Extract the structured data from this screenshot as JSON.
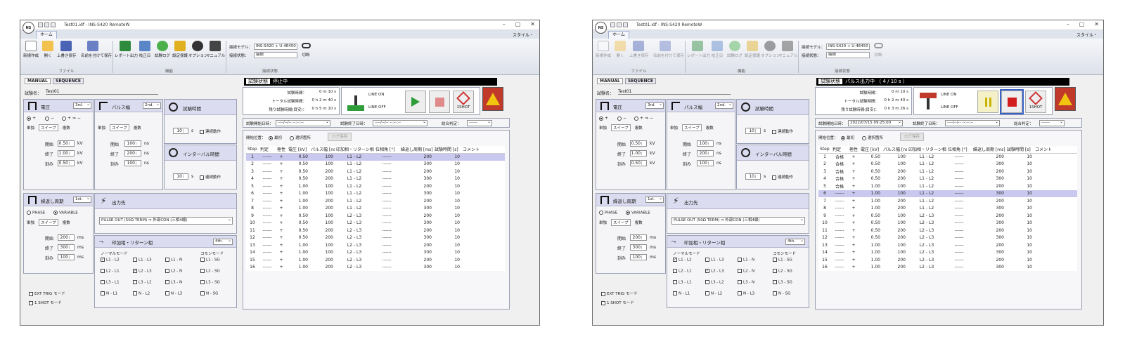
{
  "windows": [
    {
      "title": "Test01.idf - INS-S420 RemoteW",
      "tab_home": "ホーム",
      "style_label": "スタイル・",
      "ribbon": {
        "buttons": [
          "新規作成",
          "開く",
          "上書き保存",
          "名前を付けて保存",
          "レポート出力",
          "校正日",
          "試験ログ",
          "設定保護",
          "オプション",
          "マニュアル"
        ],
        "groups": [
          "ファイル",
          "機能",
          "接続状態"
        ],
        "conn_model_label": "接続モデル：",
        "conn_model_value": "INS-S420 + U-4E450",
        "conn_state_label": "接続状態：",
        "conn_state_value": "接続",
        "disconnect": "切断"
      },
      "mode_tabs": [
        "MANUAL",
        "SEQUENCE"
      ],
      "test_name_label": "試験名：",
      "test_name_value": "Test01",
      "voltage": {
        "title": "電圧",
        "order": "3rd.",
        "polarity": [
          "+",
          "−",
          "+ ⇒ −"
        ],
        "subtabs": [
          "単独",
          "スイープ",
          "複数"
        ],
        "rows": [
          {
            "label": "開始",
            "value": "0.50",
            "unit": "kV"
          },
          {
            "label": "終了",
            "value": "1.00",
            "unit": "kV"
          },
          {
            "label": "刻み",
            "value": "0.50",
            "unit": "kV"
          }
        ]
      },
      "pulse": {
        "title": "パルス幅",
        "order": "2nd.",
        "subtabs": [
          "単独",
          "スイープ",
          "複数"
        ],
        "rows": [
          {
            "label": "開始",
            "value": "100",
            "unit": "ns"
          },
          {
            "label": "終了",
            "value": "200",
            "unit": "ns"
          },
          {
            "label": "刻み",
            "value": "100",
            "unit": "ns"
          }
        ]
      },
      "test_time": {
        "title": "試験時間",
        "value": "10",
        "unit": "s",
        "chk": "連続動作"
      },
      "interval": {
        "title": "インターバル時間",
        "value": "10",
        "unit": "s",
        "chk": "連続動作"
      },
      "repeat": {
        "title": "繰返し周期",
        "order": "1st.",
        "modes": [
          "PHASE",
          "VARIABLE"
        ],
        "subtabs": [
          "単独",
          "スイープ",
          "複数"
        ],
        "rows": [
          {
            "label": "開始",
            "value": "200",
            "unit": "ms"
          },
          {
            "label": "終了",
            "value": "300",
            "unit": "ms"
          },
          {
            "label": "刻み",
            "value": "100",
            "unit": "ms"
          }
        ]
      },
      "output": {
        "title": "出力先",
        "value": "PULSE OUT (50Ω TERM) ⇒ 外部CDN (三相4線)"
      },
      "apply_phase": {
        "title": "印加相・リターン相",
        "order": "4th.",
        "normal_label": "ノーマルモード",
        "common_label": "コモンモード",
        "normal": [
          [
            "L1 - L2",
            "L1 - L3",
            "L1 - N"
          ],
          [
            "L2 - L1",
            "L2 - L3",
            "L2 - N"
          ],
          [
            "L3 - L1",
            "L3 - L2",
            "L3 - N"
          ],
          [
            "N - L1",
            "N - L2",
            "N - L3"
          ]
        ],
        "normal_checked": [
          [
            true,
            false,
            false
          ],
          [
            false,
            true,
            false
          ],
          [
            false,
            false,
            false
          ],
          [
            false,
            false,
            false
          ]
        ],
        "common": [
          "L1 - SG",
          "L2 - SG",
          "L3 - SG",
          "N - SG"
        ]
      },
      "ext_trig": "EXT TRIG モード",
      "one_shot_mode": "1 SHOT モード",
      "status": {
        "label": "試験状態",
        "value": "停止中"
      },
      "times": [
        {
          "label": "試験時間：",
          "value": "0 m  10 s"
        },
        {
          "label": "トータル試験時間：",
          "value": "0 h   2 m  40 s"
        },
        {
          "label": "残り試験時間(目安)：",
          "value": "0 h   5 m  10 s"
        }
      ],
      "line_on": "LINE ON",
      "line_off": "LINE OFF",
      "one_shot": "1SHOT",
      "start_label": "試験開始日時：",
      "start_value": "----/--/-- --:--:--",
      "end_label": "試験終了日時：",
      "end_value": "----/--/-- --:--:--",
      "verdict_label": "総合判定：",
      "verdict_value": "------",
      "start_pos_label": "開始位置：",
      "start_pos_opts": [
        "最初",
        "選択箇所"
      ],
      "log_save": "ログ保存",
      "table": {
        "headers": [
          "Step",
          "判定",
          "極性",
          "電圧 [kV]",
          "パルス幅 [ns]",
          "印加相・リターン相",
          "位相角 [°]",
          "繰返し周期 [ms]",
          "試験時間 [s]",
          "コメント"
        ],
        "rows": [
          [
            "1",
            "------",
            "+",
            "0.50",
            "100",
            "L1 - L2",
            "------",
            "200",
            "10"
          ],
          [
            "2",
            "------",
            "+",
            "0.50",
            "100",
            "L1 - L2",
            "------",
            "300",
            "10"
          ],
          [
            "3",
            "------",
            "+",
            "0.50",
            "200",
            "L1 - L2",
            "------",
            "200",
            "10"
          ],
          [
            "4",
            "------",
            "+",
            "0.50",
            "200",
            "L1 - L2",
            "------",
            "300",
            "10"
          ],
          [
            "5",
            "------",
            "+",
            "1.00",
            "100",
            "L1 - L2",
            "------",
            "200",
            "10"
          ],
          [
            "6",
            "------",
            "+",
            "1.00",
            "100",
            "L1 - L2",
            "------",
            "300",
            "10"
          ],
          [
            "7",
            "------",
            "+",
            "1.00",
            "200",
            "L1 - L2",
            "------",
            "200",
            "10"
          ],
          [
            "8",
            "------",
            "+",
            "1.00",
            "200",
            "L1 - L2",
            "------",
            "300",
            "10"
          ],
          [
            "9",
            "------",
            "+",
            "0.50",
            "100",
            "L2 - L3",
            "------",
            "200",
            "10"
          ],
          [
            "10",
            "------",
            "+",
            "0.50",
            "100",
            "L2 - L3",
            "------",
            "300",
            "10"
          ],
          [
            "11",
            "------",
            "+",
            "0.50",
            "200",
            "L2 - L3",
            "------",
            "200",
            "10"
          ],
          [
            "12",
            "------",
            "+",
            "0.50",
            "200",
            "L2 - L3",
            "------",
            "300",
            "10"
          ],
          [
            "13",
            "------",
            "+",
            "1.00",
            "100",
            "L2 - L3",
            "------",
            "200",
            "10"
          ],
          [
            "14",
            "------",
            "+",
            "1.00",
            "100",
            "L2 - L3",
            "------",
            "300",
            "10"
          ],
          [
            "15",
            "------",
            "+",
            "1.00",
            "200",
            "L2 - L3",
            "------",
            "200",
            "10"
          ],
          [
            "16",
            "------",
            "+",
            "1.00",
            "200",
            "L2 - L3",
            "------",
            "300",
            "10"
          ]
        ]
      }
    },
    {
      "title": "Test01.idf - INS-S420 RemoteW",
      "tab_home": "ホーム",
      "style_label": "スタイル・",
      "ribbon": {
        "buttons": [
          "新規作成",
          "開く",
          "上書き保存",
          "名前を付けて保存",
          "レポート出力",
          "校正日",
          "試験ログ",
          "設定保護",
          "オプション",
          "マニュアル"
        ],
        "groups": [
          "ファイル",
          "機能",
          "接続状態"
        ],
        "conn_model_label": "接続モデル：",
        "conn_model_value": "INS-S420 + U-4E450",
        "conn_state_label": "接続状態：",
        "conn_state_value": "接続",
        "disconnect": "切断"
      },
      "mode_tabs": [
        "MANUAL",
        "SEQUENCE"
      ],
      "test_name_label": "試験名：",
      "test_name_value": "Test01",
      "voltage": {
        "title": "電圧",
        "order": "3rd.",
        "polarity": [
          "+",
          "−",
          "+ ⇒ −"
        ],
        "subtabs": [
          "単独",
          "スイープ",
          "複数"
        ],
        "rows": [
          {
            "label": "開始",
            "value": "0.50",
            "unit": "kV"
          },
          {
            "label": "終了",
            "value": "1.00",
            "unit": "kV"
          },
          {
            "label": "刻み",
            "value": "0.50",
            "unit": "kV"
          }
        ]
      },
      "pulse": {
        "title": "パルス幅",
        "order": "2nd.",
        "subtabs": [
          "単独",
          "スイープ",
          "複数"
        ],
        "rows": [
          {
            "label": "開始",
            "value": "100",
            "unit": "ns"
          },
          {
            "label": "終了",
            "value": "200",
            "unit": "ns"
          },
          {
            "label": "刻み",
            "value": "100",
            "unit": "ns"
          }
        ]
      },
      "test_time": {
        "title": "試験時間",
        "value": "10",
        "unit": "s",
        "chk": "連続動作"
      },
      "interval": {
        "title": "インターバル時間",
        "value": "10",
        "unit": "s",
        "chk": "連続動作"
      },
      "repeat": {
        "title": "繰返し周期",
        "order": "1st.",
        "modes": [
          "PHASE",
          "VARIABLE"
        ],
        "subtabs": [
          "単独",
          "スイープ",
          "複数"
        ],
        "rows": [
          {
            "label": "開始",
            "value": "200",
            "unit": "ms"
          },
          {
            "label": "終了",
            "value": "300",
            "unit": "ms"
          },
          {
            "label": "刻み",
            "value": "100",
            "unit": "ms"
          }
        ]
      },
      "output": {
        "title": "出力先",
        "value": "PULSE OUT (50Ω TERM) ⇒ 外部CDN (三相4線)"
      },
      "apply_phase": {
        "title": "印加相・リターン相",
        "order": "4th.",
        "normal_label": "ノーマルモード",
        "common_label": "コモンモード",
        "normal": [
          [
            "L1 - L2",
            "L1 - L3",
            "L1 - N"
          ],
          [
            "L2 - L1",
            "L2 - L3",
            "L2 - N"
          ],
          [
            "L3 - L1",
            "L3 - L2",
            "L3 - N"
          ],
          [
            "N - L1",
            "N - L2",
            "N - L3"
          ]
        ],
        "normal_checked": [
          [
            true,
            false,
            false
          ],
          [
            false,
            true,
            false
          ],
          [
            false,
            false,
            false
          ],
          [
            false,
            false,
            false
          ]
        ],
        "common": [
          "L1 - SG",
          "L2 - SG",
          "L3 - SG",
          "N - SG"
        ]
      },
      "ext_trig": "EXT TRIG モード",
      "one_shot_mode": "1 SHOT モード",
      "status": {
        "label": "試験状態",
        "value": "パルス出力中 （ 4 / 10 s ）"
      },
      "times": [
        {
          "label": "試験時間：",
          "value": "0 m  10 s"
        },
        {
          "label": "トータル試験時間：",
          "value": "0 h   2 m  40 s"
        },
        {
          "label": "残り試験時間(目安)：",
          "value": "0 h   3 m  26 s"
        }
      ],
      "line_on": "LINE ON",
      "line_off": "LINE OFF",
      "one_shot": "1SHOT",
      "start_label": "試験開始日時：",
      "start_value": "2022/07/15 09:25:00",
      "end_label": "試験終了日時：",
      "end_value": "----/--/-- --:--:--",
      "verdict_label": "総合判定：",
      "verdict_value": "------",
      "start_pos_label": "開始位置：",
      "start_pos_opts": [
        "最初",
        "選択箇所"
      ],
      "log_save": "ログ保存",
      "table": {
        "headers": [
          "Step",
          "判定",
          "極性",
          "電圧 [kV]",
          "パルス幅 [ns]",
          "印加相・リターン相",
          "位相角 [°]",
          "繰返し周期 [ms]",
          "試験時間 [s]",
          "コメント"
        ],
        "rows": [
          [
            "1",
            "合格",
            "+",
            "0.50",
            "100",
            "L1 - L2",
            "------",
            "200",
            "10"
          ],
          [
            "2",
            "合格",
            "+",
            "0.50",
            "100",
            "L1 - L2",
            "------",
            "300",
            "10"
          ],
          [
            "3",
            "合格",
            "+",
            "0.50",
            "200",
            "L1 - L2",
            "------",
            "200",
            "10"
          ],
          [
            "4",
            "合格",
            "+",
            "0.50",
            "200",
            "L1 - L2",
            "------",
            "300",
            "10"
          ],
          [
            "5",
            "合格",
            "+",
            "1.00",
            "100",
            "L1 - L2",
            "------",
            "200",
            "10"
          ],
          [
            "6",
            "------",
            "+",
            "1.00",
            "100",
            "L1 - L2",
            "------",
            "300",
            "10"
          ],
          [
            "7",
            "------",
            "+",
            "1.00",
            "200",
            "L1 - L2",
            "------",
            "200",
            "10"
          ],
          [
            "8",
            "------",
            "+",
            "1.00",
            "200",
            "L1 - L2",
            "------",
            "300",
            "10"
          ],
          [
            "9",
            "------",
            "+",
            "0.50",
            "100",
            "L2 - L3",
            "------",
            "200",
            "10"
          ],
          [
            "10",
            "------",
            "+",
            "0.50",
            "100",
            "L2 - L3",
            "------",
            "300",
            "10"
          ],
          [
            "11",
            "------",
            "+",
            "0.50",
            "200",
            "L2 - L3",
            "------",
            "200",
            "10"
          ],
          [
            "12",
            "------",
            "+",
            "0.50",
            "200",
            "L2 - L3",
            "------",
            "300",
            "10"
          ],
          [
            "13",
            "------",
            "+",
            "1.00",
            "100",
            "L2 - L3",
            "------",
            "200",
            "10"
          ],
          [
            "14",
            "------",
            "+",
            "1.00",
            "100",
            "L2 - L3",
            "------",
            "300",
            "10"
          ],
          [
            "15",
            "------",
            "+",
            "1.00",
            "200",
            "L2 - L3",
            "------",
            "200",
            "10"
          ],
          [
            "16",
            "------",
            "+",
            "1.00",
            "200",
            "L2 - L3",
            "------",
            "300",
            "10"
          ]
        ]
      }
    }
  ]
}
